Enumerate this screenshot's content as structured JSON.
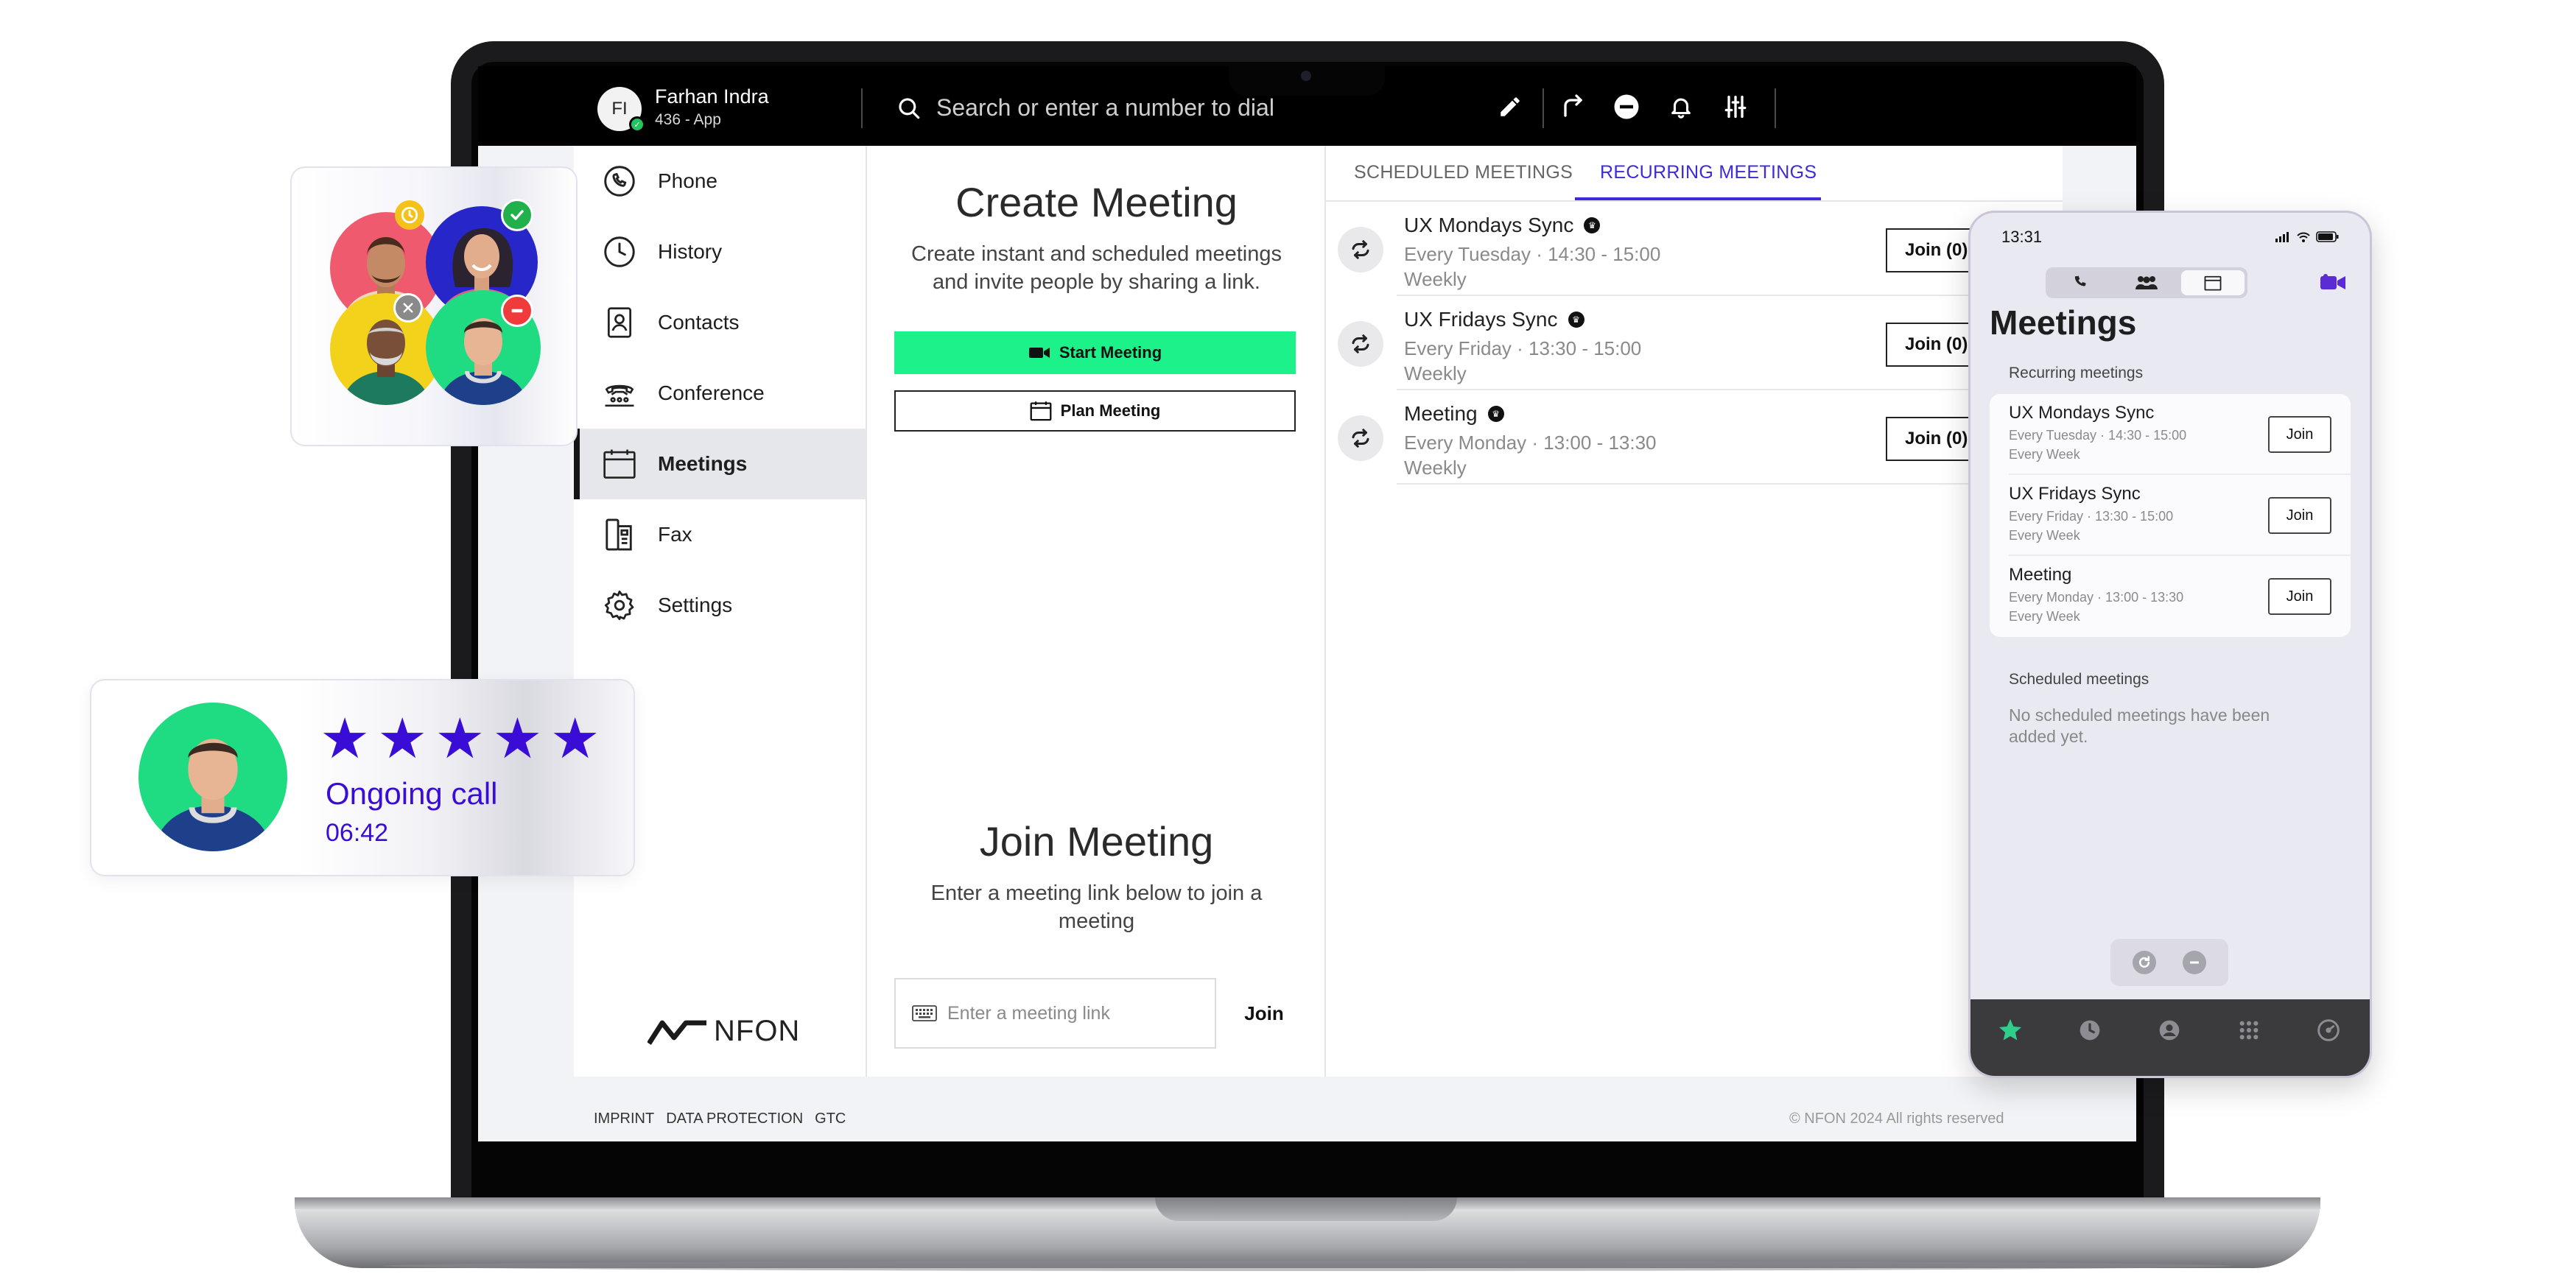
{
  "topbar": {
    "user_initials": "FI",
    "user_name": "Farhan Indra",
    "user_subtitle": "436 - App",
    "search_placeholder": "Search or enter a number to dial"
  },
  "sidebar": {
    "items": [
      {
        "label": "Phone",
        "icon": "phone-icon"
      },
      {
        "label": "History",
        "icon": "clock-icon"
      },
      {
        "label": "Contacts",
        "icon": "contact-card-icon"
      },
      {
        "label": "Conference",
        "icon": "conference-phone-icon"
      },
      {
        "label": "Meetings",
        "icon": "calendar-icon",
        "active": true
      },
      {
        "label": "Fax",
        "icon": "fax-icon"
      },
      {
        "label": "Settings",
        "icon": "gear-icon"
      }
    ],
    "logo_text": "NFON"
  },
  "create": {
    "title": "Create Meeting",
    "description": "Create instant and scheduled meetings and invite people by sharing a link.",
    "start_label": "Start Meeting",
    "plan_label": "Plan Meeting"
  },
  "join": {
    "title": "Join Meeting",
    "description": "Enter a meeting link below to join a meeting",
    "link_placeholder": "Enter a meeting link",
    "join_label": "Join"
  },
  "tabs": {
    "scheduled": "SCHEDULED MEETINGS",
    "recurring": "RECURRING MEETINGS",
    "active": "recurring"
  },
  "meetings": [
    {
      "title": "UX Mondays Sync",
      "schedule": "Every Tuesday · 14:30 - 15:00",
      "frequency": "Weekly",
      "join_label": "Join (0)"
    },
    {
      "title": "UX Fridays Sync",
      "schedule": "Every Friday · 13:30 - 15:00",
      "frequency": "Weekly",
      "join_label": "Join (0)"
    },
    {
      "title": "Meeting",
      "schedule": "Every Monday · 13:00 - 13:30",
      "frequency": "Weekly",
      "join_label": "Join (0)"
    }
  ],
  "footer": {
    "imprint": "IMPRINT",
    "data_protection": "DATA PROTECTION",
    "gtc": "GTC",
    "copyright": "© NFON 2024 All rights reserved"
  },
  "phone": {
    "time": "13:31",
    "title": "Meetings",
    "recurring_section": "Recurring meetings",
    "recurring": [
      {
        "title": "UX Mondays Sync",
        "schedule": "Every Tuesday · 14:30 - 15:00",
        "frequency": "Every Week",
        "join_label": "Join"
      },
      {
        "title": "UX Fridays Sync",
        "schedule": "Every Friday · 13:30 - 15:00",
        "frequency": "Every Week",
        "join_label": "Join"
      },
      {
        "title": "Meeting",
        "schedule": "Every Monday · 13:00 - 13:30",
        "frequency": "Every Week",
        "join_label": "Join"
      }
    ],
    "scheduled_section": "Scheduled meetings",
    "empty_text": "No scheduled meetings have been added yet."
  },
  "call_card": {
    "rating": 5,
    "status": "Ongoing call",
    "timer": "06:42"
  },
  "colors": {
    "accent": "#3d2bd9",
    "start_button": "#1df18a",
    "presence": "#22c55e",
    "star": "#3a0dd6",
    "phone_active_tab": "#2ecf8a"
  }
}
